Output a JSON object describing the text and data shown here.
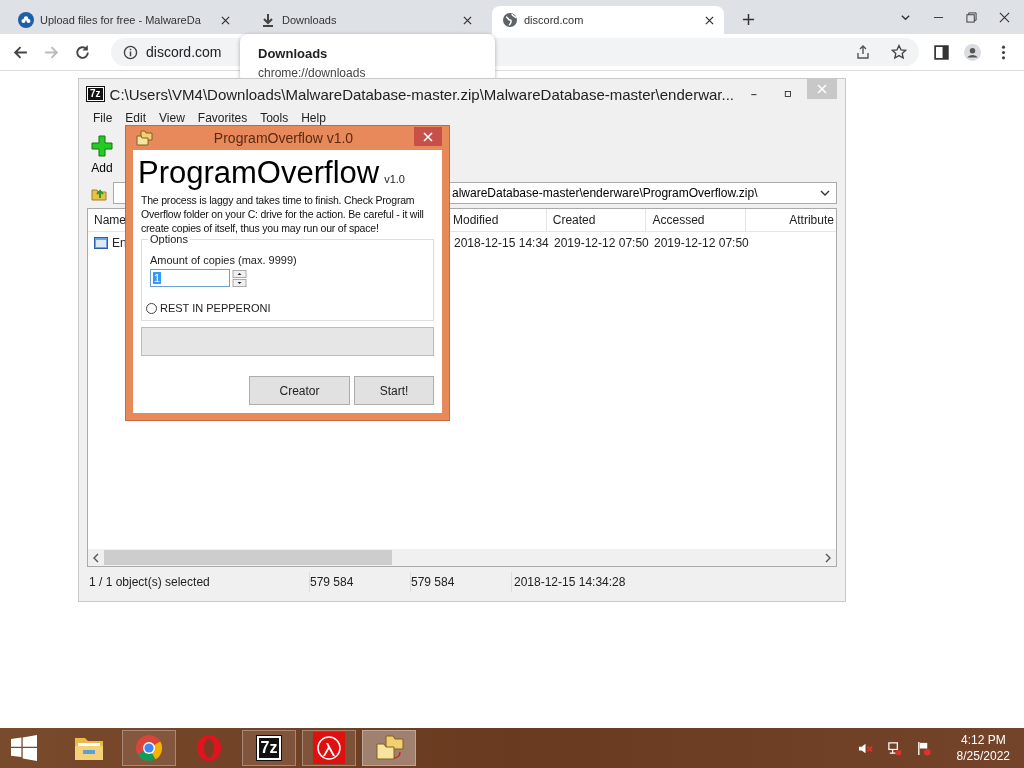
{
  "browser": {
    "tabs": [
      {
        "label": "Upload files for free - MalwareDa",
        "kind": "cloud",
        "selected": false
      },
      {
        "label": "Downloads",
        "kind": "download",
        "selected": false
      },
      {
        "label": "discord.com",
        "kind": "globe",
        "selected": true
      }
    ],
    "address": "discord.com",
    "tab_card": {
      "title": "Downloads",
      "url": "chrome://downloads"
    }
  },
  "archive_window": {
    "icon_text": "7z",
    "title": "C:\\Users\\VM4\\Downloads\\MalwareDatabase-master.zip\\MalwareDatabase-master\\enderwar...",
    "menu": [
      "File",
      "Edit",
      "View",
      "Favorites",
      "Tools",
      "Help"
    ],
    "toolbar": [
      {
        "label": "Add"
      }
    ],
    "path": "alwareDatabase-master\\enderware\\ProgramOverflow.zip\\",
    "columns": [
      "Name",
      "Modified",
      "Created",
      "Accessed",
      "Attribute"
    ],
    "rows": [
      {
        "name": "En",
        "modified": "2018-12-15 14:34",
        "created": "2019-12-12 07:50",
        "accessed": "2019-12-12 07:50"
      }
    ],
    "status": [
      "1 / 1 object(s) selected",
      "579 584",
      "579 584",
      "2018-12-15 14:34:28"
    ]
  },
  "dialog": {
    "title": "ProgramOverflow v1.0",
    "heading": "ProgramOverflow",
    "version": "v1.0",
    "description": "The process is laggy and takes time to finish. Check Program Overflow folder on your C: drive for the action. Be careful - it will create copies of itself, thus you may run our of space!",
    "options": {
      "legend": "Options",
      "copies_label": "Amount of copies (max. 9999)",
      "copies_value": "1",
      "radio": {
        "label": "REST IN PEPPERONI",
        "selected": false
      }
    },
    "progress": {
      "level": 0
    },
    "buttons": [
      "Creator",
      "Start!"
    ]
  },
  "taskbar": {
    "apps": [
      {
        "kind": "folder",
        "running": false,
        "selected": false
      },
      {
        "kind": "chrome",
        "running": true,
        "selected": false
      },
      {
        "kind": "opera",
        "running": false,
        "selected": false
      },
      {
        "kind": "sevenzip",
        "label": "7z",
        "running": true,
        "selected": false
      },
      {
        "kind": "lambda",
        "running": true,
        "selected": false
      },
      {
        "kind": "copier",
        "running": true,
        "selected": true
      }
    ],
    "time": "4:12 PM",
    "date": "8/25/2022"
  }
}
